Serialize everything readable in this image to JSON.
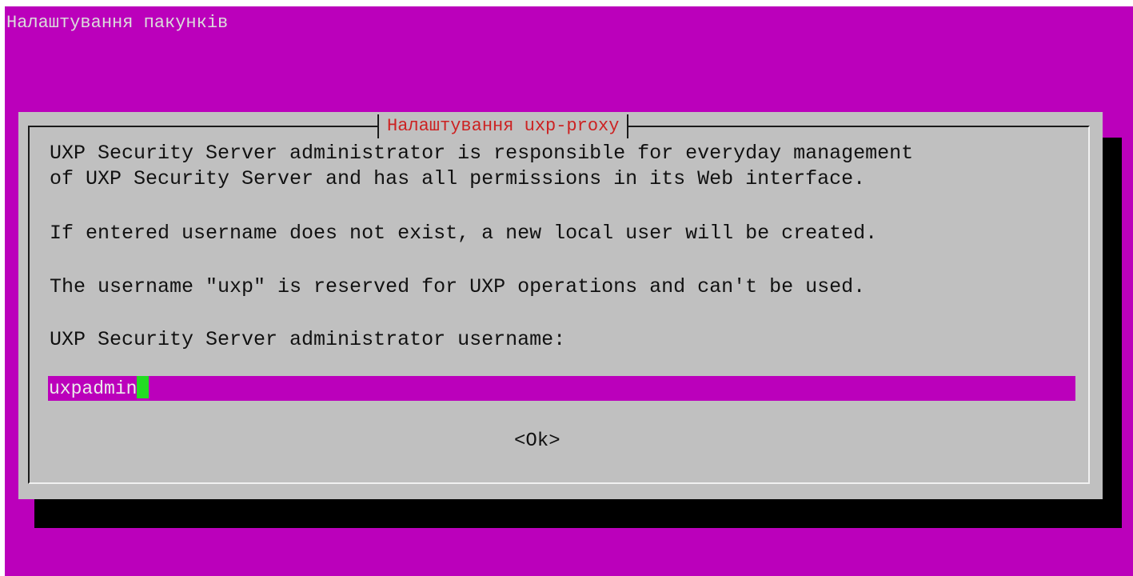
{
  "screen": {
    "backtitle": "Налаштування пакунків"
  },
  "dialog": {
    "title": "Налаштування uxp-proxy",
    "lines": [
      "UXP Security Server administrator is responsible for everyday management",
      "of UXP Security Server and has all permissions in its Web interface.",
      "If entered username does not exist, a new local user will be created.",
      "The username \"uxp\" is reserved for UXP operations and can't be used.",
      "UXP Security Server administrator username:"
    ],
    "input": {
      "value": "uxpadmin"
    },
    "ok_button": "<Ok>"
  },
  "colors": {
    "background": "#bb00bb",
    "dialog": "#c0c0c0",
    "title_text": "#cc2222",
    "cursor": "#22dd22"
  }
}
